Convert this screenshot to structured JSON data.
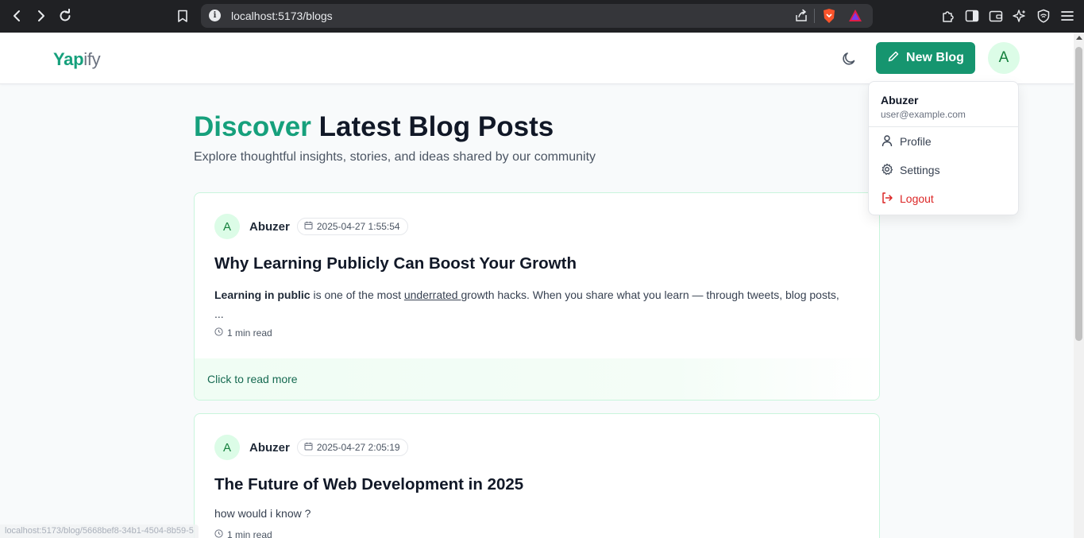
{
  "browser": {
    "url": "localhost:5173/blogs",
    "status_url": "localhost:5173/blog/5668bef8-34b1-4504-8b59-5"
  },
  "header": {
    "logo_bold": "Yap",
    "logo_light": "ify",
    "new_blog_label": "New Blog",
    "avatar_initial": "A"
  },
  "hero": {
    "title_accent": "Discover",
    "title_rest": " Latest Blog Posts",
    "subtitle": "Explore thoughtful insights, stories, and ideas shared by our community"
  },
  "posts": [
    {
      "avatar_initial": "A",
      "author": "Abuzer",
      "date": "2025-04-27 1:55:54",
      "title": "Why Learning Publicly Can Boost Your Growth",
      "excerpt_bold": "Learning in public",
      "excerpt_mid": " is one of the most ",
      "excerpt_underline": "underrated ",
      "excerpt_rest": "growth hacks. When you share what you learn — through tweets, blog posts,",
      "excerpt_more": "...",
      "read_time": "1 min read",
      "read_more": "Click to read more"
    },
    {
      "avatar_initial": "A",
      "author": "Abuzer",
      "date": "2025-04-27 2:05:19",
      "title": "The Future of Web Development in 2025",
      "excerpt": "how would i know ?",
      "read_time": "1 min read"
    }
  ],
  "dropdown": {
    "name": "Abuzer",
    "email": "user@example.com",
    "items": [
      {
        "label": "Profile",
        "icon": "user-icon"
      },
      {
        "label": "Settings",
        "icon": "gear-icon"
      },
      {
        "label": "Logout",
        "icon": "logout-icon"
      }
    ]
  },
  "colors": {
    "brand": "#16a07c",
    "button": "#16956f",
    "logout": "#dc2626"
  }
}
